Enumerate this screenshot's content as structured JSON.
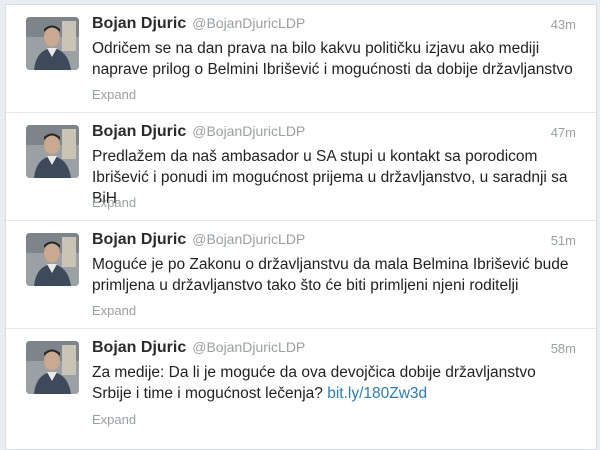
{
  "tweets": [
    {
      "fullname": "Bojan Djuric",
      "username": "@BojanDjuricLDP",
      "time": "43m",
      "text": "Odričem se na dan prava na bilo kakvu političku izjavu ako mediji\nnaprave prilog o Belmini Ibrišević i mogućnosti da dobije državljanstvo",
      "link": "",
      "expand": "Expand"
    },
    {
      "fullname": "Bojan Djuric",
      "username": "@BojanDjuricLDP",
      "time": "47m",
      "text": "Predlažem da naš ambasador u SA stupi u kontakt sa porodicom\nIbrišević i ponudi im mogućnost prijema u državljanstvo, u saradnji sa\nBiH",
      "link": "",
      "expand": "Expand"
    },
    {
      "fullname": "Bojan Djuric",
      "username": "@BojanDjuricLDP",
      "time": "51m",
      "text": "Moguće je po Zakonu o državljanstvu da mala Belmina Ibrišević bude\nprimljena u državljanstvo tako što će biti primljeni njeni roditelji",
      "link": "",
      "expand": "Expand"
    },
    {
      "fullname": "Bojan Djuric",
      "username": "@BojanDjuricLDP",
      "time": "58m",
      "text": "Za medije: Da li je moguće da ova devojčica dobije državljanstvo\nSrbije i time i mogućnost lečenja? ",
      "link": "bit.ly/180Zw3d",
      "expand": "Expand"
    }
  ]
}
